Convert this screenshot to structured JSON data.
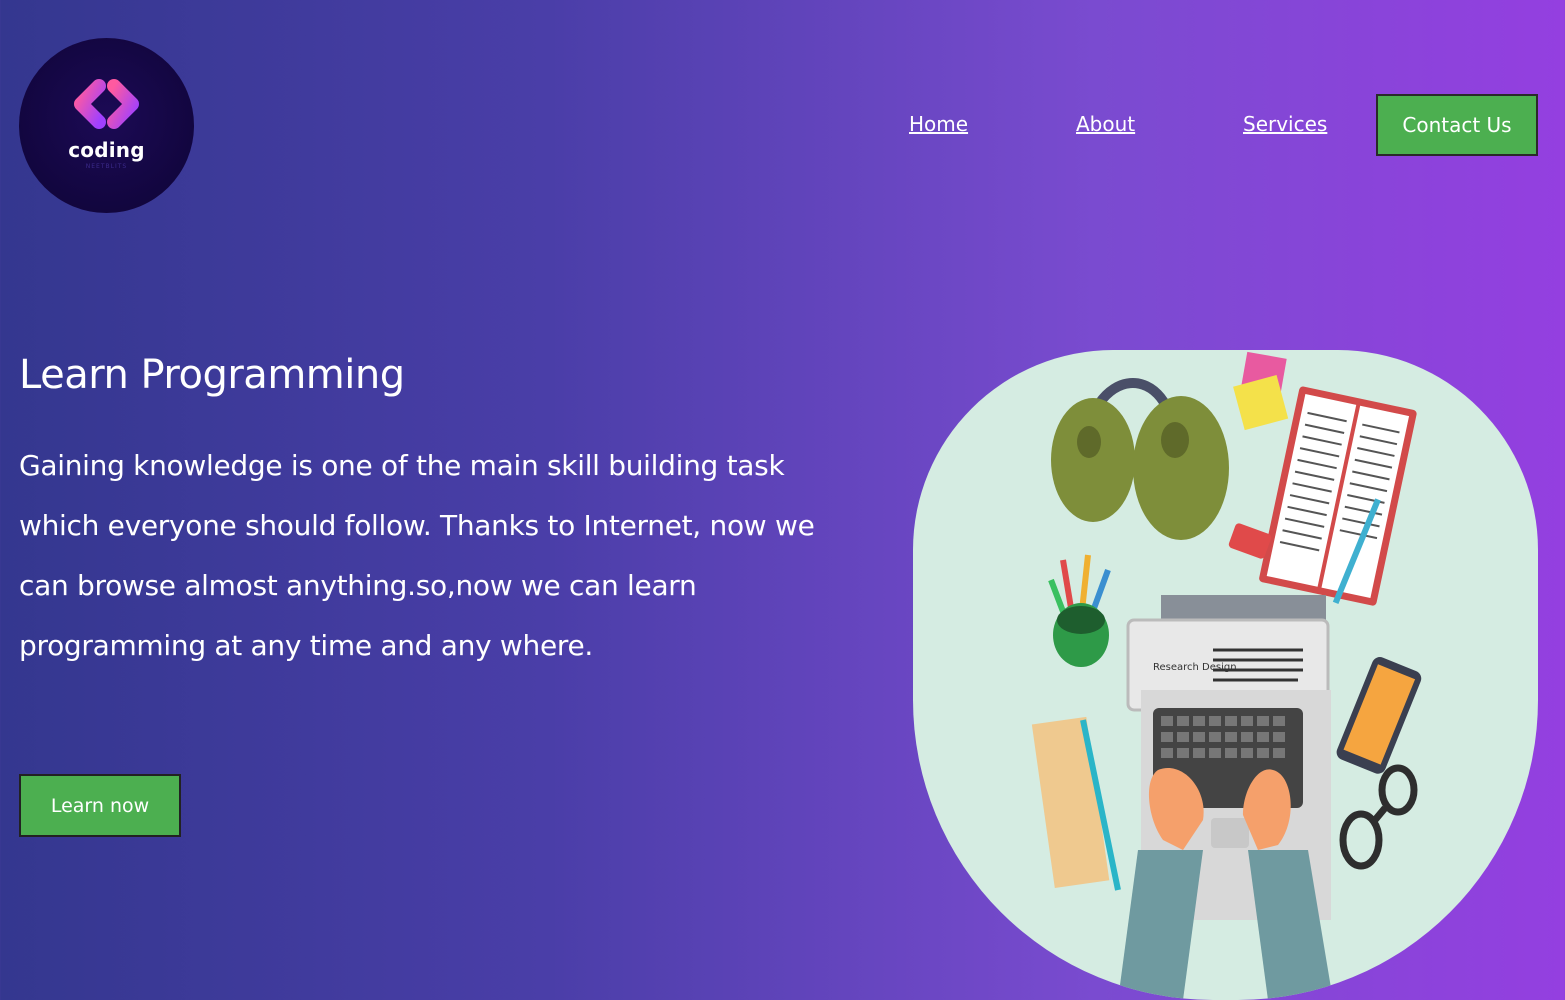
{
  "logo": {
    "word": "coding",
    "sub": "NEETBLITS"
  },
  "nav": {
    "home": "Home",
    "about": "About",
    "services": "Services",
    "contact": "Contact Us"
  },
  "hero": {
    "title": "Learn Programming",
    "text": "Gaining knowledge is one of the main skill building task which everyone should follow. Thanks to Internet, now we can browse almost anything.so,now we can learn programming at any time and any where.",
    "button": "Learn now"
  },
  "illustration": {
    "screen_label": "Research Design"
  },
  "colors": {
    "accent_green": "#4caf50",
    "bg_left": "#34378f",
    "bg_right": "#943fe0",
    "art_bg": "#d5ece2"
  }
}
